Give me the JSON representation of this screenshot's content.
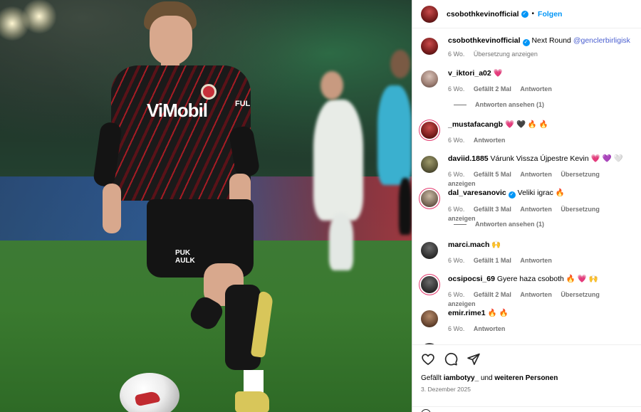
{
  "post": {
    "author": "csobothkevinofficial",
    "follow_label": "Folgen",
    "separator": "•",
    "caption": {
      "text": "Next Round",
      "mention": "@genclerbirligisk",
      "age": "6 Wo.",
      "translate_label": "Übersetzung anzeigen"
    }
  },
  "photo": {
    "sponsor_text": "ViMobil",
    "sleeve_text": "FUL",
    "shorts_text": "PUK AULK"
  },
  "comments": [
    {
      "user": "v_iktori_a02",
      "text": "💗",
      "age": "6 Wo.",
      "likes": "Gefällt 2 Mal",
      "reply": "Antworten",
      "translate": "",
      "view_replies": "Antworten ansehen (1)"
    },
    {
      "user": "_mustafacangb",
      "text": "💗 🖤 🔥 🔥",
      "age": "6 Wo.",
      "likes": "",
      "reply": "Antworten",
      "translate": "",
      "view_replies": ""
    },
    {
      "user": "daviid.1885",
      "text": "Várunk Vissza Újpestre Kevin 💗 💜 🤍",
      "age": "6 Wo.",
      "likes": "Gefällt 5 Mal",
      "reply": "Antworten",
      "translate": "Übersetzung anzeigen",
      "view_replies": ""
    },
    {
      "user": "dal_varesanovic",
      "text": "Veliki igrac 🔥",
      "age": "6 Wo.",
      "likes": "Gefällt 3 Mal",
      "reply": "Antworten",
      "translate": "Übersetzung anzeigen",
      "view_replies": "Antworten ansehen (1)"
    },
    {
      "user": "marci.mach",
      "text": "🙌",
      "age": "6 Wo.",
      "likes": "Gefällt 1 Mal",
      "reply": "Antworten",
      "translate": "",
      "view_replies": ""
    },
    {
      "user": "ocsipocsi_69",
      "text": "Gyere haza csoboth 🔥 💗 🙌",
      "age": "6 Wo.",
      "likes": "Gefällt 2 Mal",
      "reply": "Antworten",
      "translate": "Übersetzung anzeigen",
      "view_replies": ""
    },
    {
      "user": "emir.rime1",
      "text": "🔥 🔥",
      "age": "6 Wo.",
      "likes": "",
      "reply": "Antworten",
      "translate": "",
      "view_replies": ""
    }
  ],
  "footer": {
    "liked_by_prefix": "Gefällt",
    "liked_by_user": "iambotyy_",
    "liked_by_middle": "und",
    "liked_by_rest": "weiteren Personen",
    "date": "3. Dezember 2025"
  },
  "colors": {
    "accent": "#0095f6",
    "muted": "#737373",
    "story_ring": "#e23a6e"
  }
}
